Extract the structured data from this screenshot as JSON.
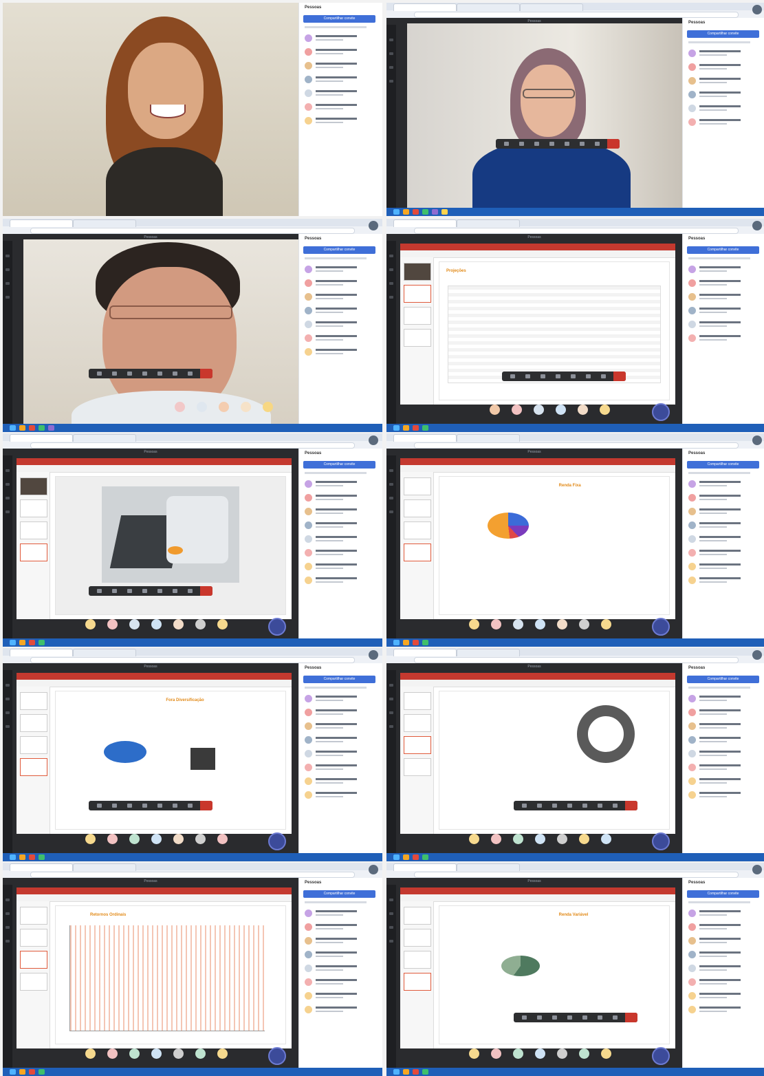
{
  "panel": {
    "title": "Pessoas",
    "share_label": "Compartilhar convite"
  },
  "meeting": {
    "window_title": "Pessoas"
  },
  "slides": {
    "s4": "Projeções",
    "s6": "Renda Fixa",
    "s7": "Fora Diversificação",
    "s9": "Retornos Ordinais",
    "s10": "Renda Variável"
  },
  "colors": {
    "accent_blue": "#3f6fd8",
    "end_call_red": "#c9372c",
    "slide_orange": "#e28a18",
    "taskbar_blue": "#1f5fb8"
  },
  "tiles": [
    {
      "id": 1,
      "kind": "video",
      "subject": "woman-smiling"
    },
    {
      "id": 2,
      "kind": "video",
      "subject": "woman-glasses"
    },
    {
      "id": 3,
      "kind": "video",
      "subject": "man-glasses"
    },
    {
      "id": 4,
      "kind": "slide",
      "content": "table"
    },
    {
      "id": 5,
      "kind": "slide",
      "content": "hero-image"
    },
    {
      "id": 6,
      "kind": "slide",
      "content": "pie"
    },
    {
      "id": 7,
      "kind": "slide",
      "content": "pie-blue"
    },
    {
      "id": 8,
      "kind": "slide",
      "content": "donut"
    },
    {
      "id": 9,
      "kind": "slide",
      "content": "line"
    },
    {
      "id": 10,
      "kind": "slide",
      "content": "pie-green"
    }
  ]
}
